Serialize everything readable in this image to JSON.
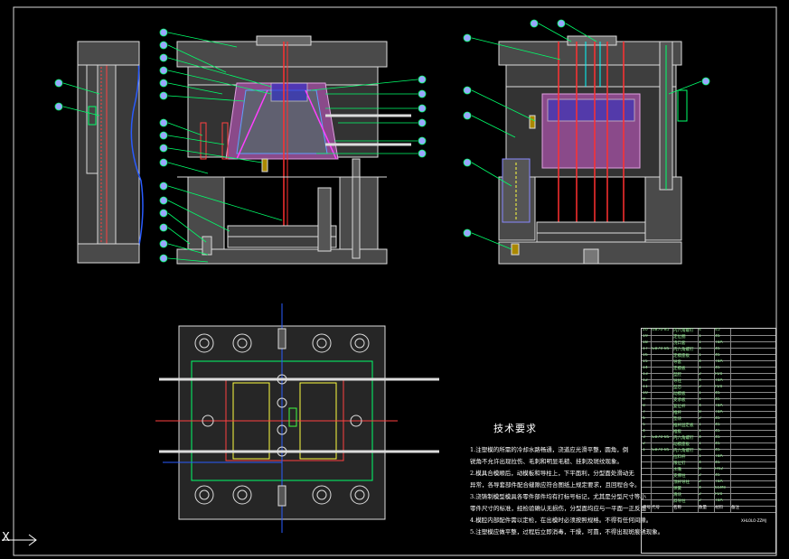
{
  "requirements": {
    "title": "技术要求",
    "items": [
      "1.注塑模的所需的冷却水路畅通，浇道应光滑平整，圆角，倒",
      "   锐角不允许出现拉伤、毛刺和明显毛糙、挂刺及斑纹现象。",
      "2.模具合模顺后，动模板和导柱上，下平面利，分型面处滑动无",
      "   异常，各导套部件配合缝隙应符合图纸上规定要求，且回程合令。",
      "3.浇铸制模型模具各零件部件均有打标号标记，尤其是分型尺寸等小",
      "   零件尺寸的标准，经检验确认无损伤，分型面均应与一平面一正反面",
      "4.模腔内部配件需以定检，在出模时必须按照规格。不得有任何间隙。",
      "5.注塑模应做平整，过程后立即消毒，干燥，可靠，不得出现斑痕锈现象。"
    ]
  },
  "title_block": {
    "header": [
      "序号",
      "代号",
      "名称",
      "数量",
      "材料",
      "备注"
    ],
    "rows": [
      [
        "20",
        "GB70-85",
        "内六角螺钉",
        "4",
        "45",
        ""
      ],
      [
        "19",
        "",
        "定位圈",
        "1",
        "45",
        ""
      ],
      [
        "18",
        "",
        "浇口套",
        "1",
        "T8A",
        ""
      ],
      [
        "17",
        "GB70-85",
        "内六角螺钉",
        "4",
        "45",
        ""
      ],
      [
        "16",
        "",
        "定模座板",
        "1",
        "45",
        ""
      ],
      [
        "15",
        "",
        "导套",
        "4",
        "T8A",
        ""
      ],
      [
        "14",
        "",
        "定模板",
        "1",
        "45",
        ""
      ],
      [
        "13",
        "",
        "型腔",
        "2",
        "P20",
        ""
      ],
      [
        "12",
        "",
        "导柱",
        "4",
        "T8A",
        ""
      ],
      [
        "11",
        "",
        "型芯",
        "2",
        "P20",
        ""
      ],
      [
        "10",
        "",
        "动模板",
        "1",
        "45",
        ""
      ],
      [
        "9",
        "",
        "支承板",
        "1",
        "45",
        ""
      ],
      [
        "8",
        "",
        "复位杆",
        "4",
        "T8A",
        ""
      ],
      [
        "7",
        "",
        "推杆",
        "8",
        "T8A",
        ""
      ],
      [
        "6",
        "",
        "垫块",
        "2",
        "45",
        ""
      ],
      [
        "5",
        "",
        "推杆固定板",
        "1",
        "45",
        ""
      ],
      [
        "4",
        "",
        "推板",
        "1",
        "45",
        ""
      ],
      [
        "3",
        "GB70-85",
        "内六角螺钉",
        "4",
        "45",
        ""
      ],
      [
        "2",
        "",
        "动模座板",
        "1",
        "45",
        ""
      ],
      [
        "1",
        "GB70-85",
        "内六角螺钉",
        "6",
        "45",
        ""
      ],
      [
        "",
        "",
        "拉料杆",
        "1",
        "T8A",
        ""
      ],
      [
        "",
        "",
        "限位钉",
        "4",
        "45",
        ""
      ],
      [
        "",
        "",
        "水嘴",
        "8",
        "H62",
        ""
      ],
      [
        "",
        "",
        "支撑柱",
        "2",
        "45",
        ""
      ],
      [
        "",
        "",
        "顶杆导柱",
        "2",
        "T8A",
        ""
      ],
      [
        "",
        "",
        "弹簧",
        "4",
        "65Mn",
        ""
      ],
      [
        "",
        "",
        "滑块",
        "2",
        "P20",
        ""
      ],
      [
        "",
        "",
        "斜导柱",
        "2",
        "T8A",
        ""
      ]
    ],
    "drawing_no": "XHLOLO-ZZMJ"
  },
  "ucs_label": "X"
}
